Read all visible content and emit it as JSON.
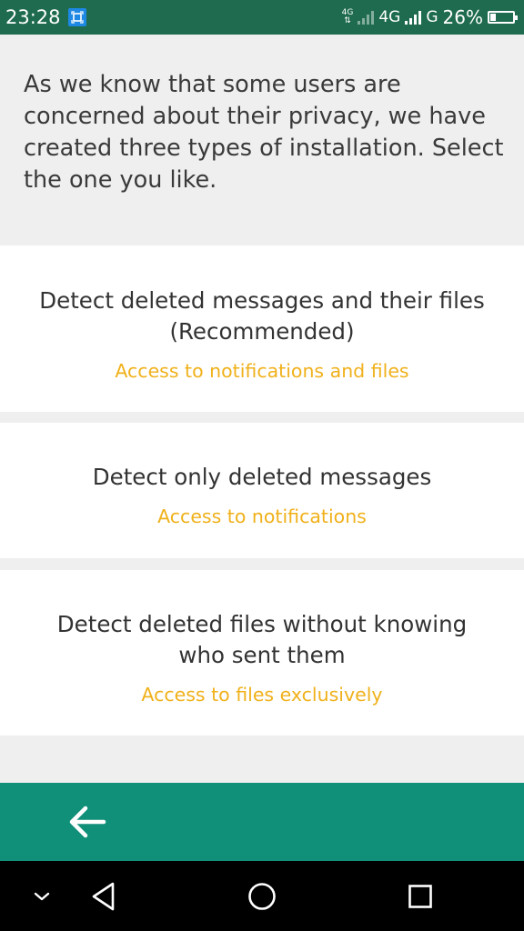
{
  "status_bar": {
    "time": "23:28",
    "network_1_label": "4G",
    "network_2_label": "4G",
    "network_3_label": "G",
    "battery_percent": "26%",
    "battery_level": 0.26,
    "icons": [
      "screenshot-icon",
      "signal-icon",
      "battery-icon"
    ]
  },
  "intro": {
    "text": "As we know that some users are concerned about their privacy, we have created three types of installation. Select the one you like."
  },
  "options": [
    {
      "title": "Detect deleted messages and their files (Recommended)",
      "subtitle": "Access to notifications and files"
    },
    {
      "title": "Detect only deleted messages",
      "subtitle": "Access to notifications"
    },
    {
      "title": "Detect deleted files without knowing who sent them",
      "subtitle": "Access to files exclusively"
    }
  ],
  "action_bar": {
    "back_icon": "arrow-left-icon"
  },
  "nav_bar": {
    "icons": [
      "chevron-down-icon",
      "back-triangle-icon",
      "home-circle-icon",
      "recents-square-icon"
    ]
  },
  "colors": {
    "status_bar": "#1e6b4f",
    "action_bar": "#108f79",
    "accent_text": "#f0b11b",
    "background": "#efefef",
    "card": "#ffffff"
  }
}
